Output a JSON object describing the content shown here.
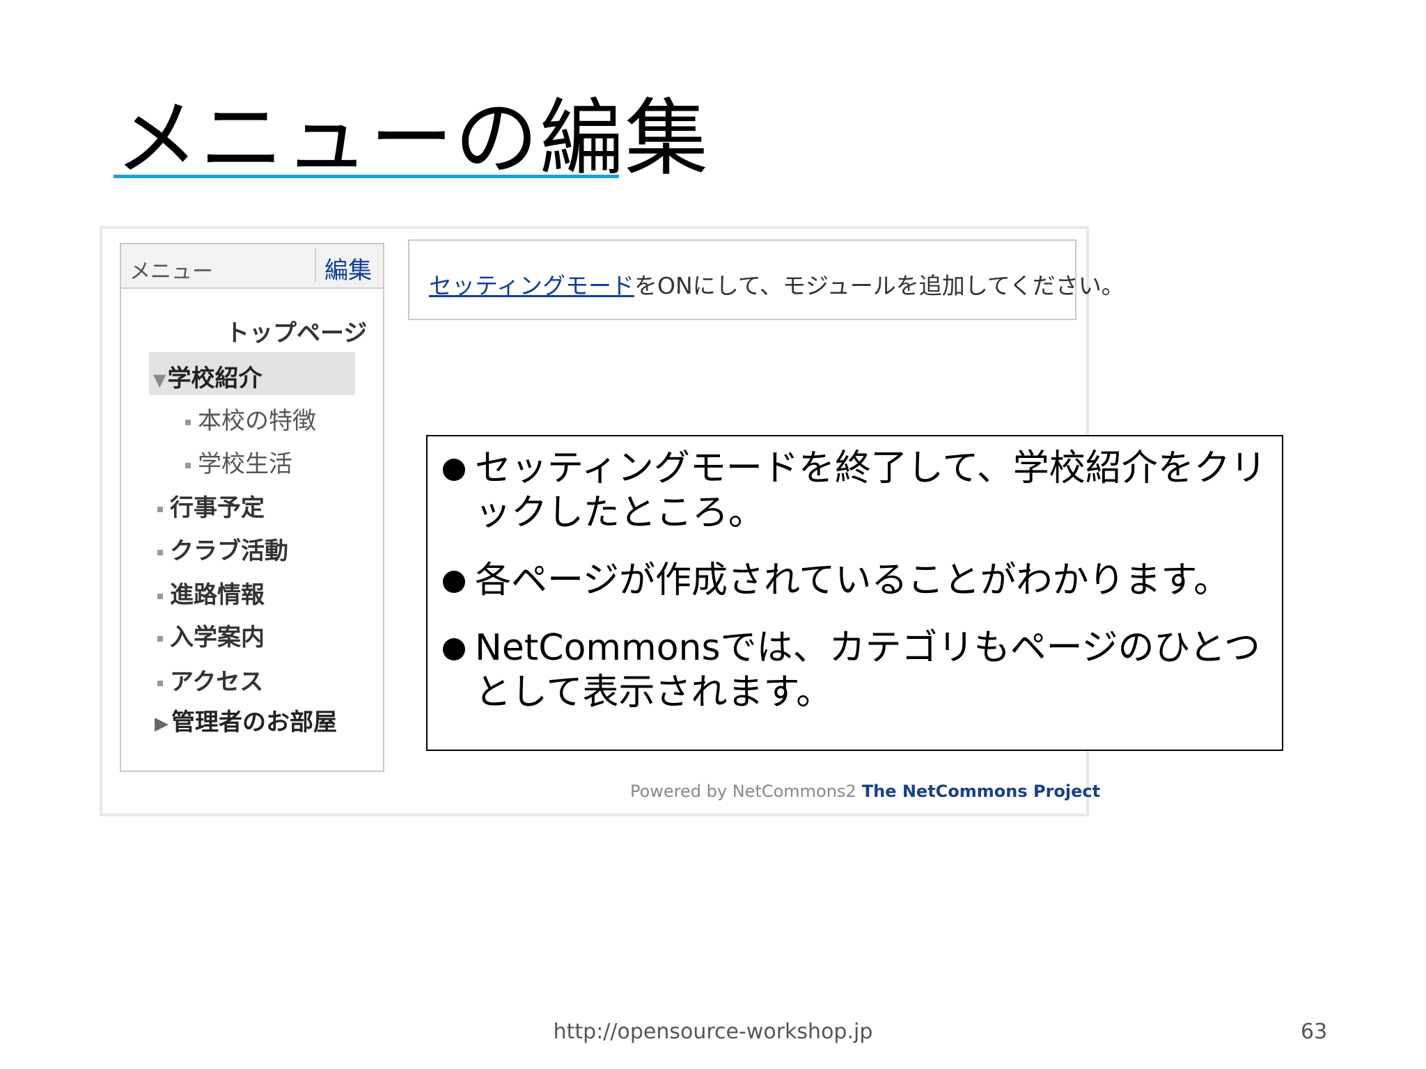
{
  "slide": {
    "title": "メニューの編集",
    "footer_url": "http://opensource-workshop.jp",
    "page_number": "63",
    "accent_color": "#1aa0d8"
  },
  "menu": {
    "header_title": "メニュー",
    "edit_label": "編集",
    "items": [
      {
        "label": "トップページ"
      },
      {
        "label": "学校紹介",
        "state": "expanded-selected"
      },
      {
        "label": "本校の特徴"
      },
      {
        "label": "学校生活"
      },
      {
        "label": "行事予定"
      },
      {
        "label": "クラブ活動"
      },
      {
        "label": "進路情報"
      },
      {
        "label": "入学案内"
      },
      {
        "label": "アクセス"
      },
      {
        "label": "管理者のお部屋",
        "state": "collapsed"
      }
    ]
  },
  "notice": {
    "link_text": "セッティングモード",
    "rest_text": "をONにして、モジュールを追加してください。"
  },
  "powered": {
    "prefix": "Powered by NetCommons2",
    "link_text": "The NetCommons Project"
  },
  "callout": {
    "bullets": [
      "セッティングモードを終了して、学校紹介をクリックしたところ。",
      "各ページが作成されていることがわかります。",
      "NetCommonsでは、カテゴリもページのひとつとして表示されます。"
    ]
  }
}
